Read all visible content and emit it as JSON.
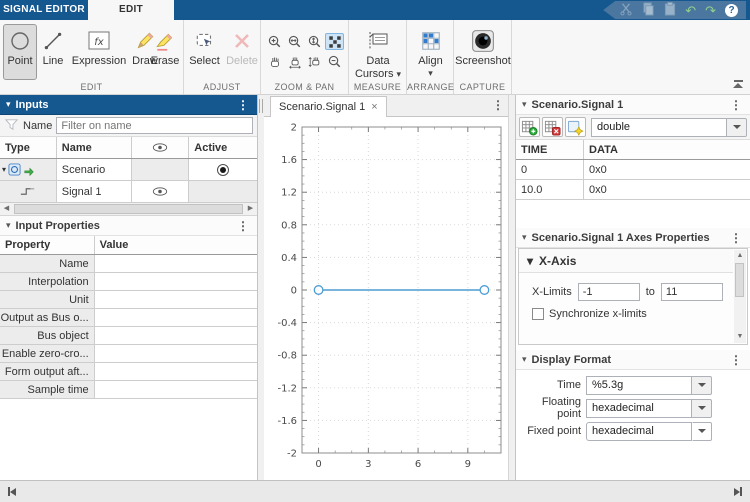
{
  "glyphs": {
    "menu_dots": "⋮",
    "caret_down": "▾",
    "close": "×",
    "undo": "↶",
    "redo": "↷",
    "help": "?",
    "left": "◀",
    "right": "▶",
    "up": "▲",
    "down": "▼"
  },
  "tabs": {
    "signal_editor": "SIGNAL EDITOR",
    "edit": "EDIT"
  },
  "toolstrip": {
    "buttons": {
      "point": "Point",
      "line": "Line",
      "expression": "Expression",
      "draw": "Draw",
      "erase": "Erase",
      "select": "Select",
      "delete": "Delete",
      "data_cursors_line1": "Data",
      "data_cursors_line2": "Cursors",
      "align": "Align",
      "screenshot": "Screenshot"
    },
    "sections": {
      "edit": "EDIT",
      "adjust": "ADJUST",
      "zoom_pan": "ZOOM & PAN",
      "measure": "MEASURE",
      "arrange": "ARRANGE",
      "capture": "CAPTURE"
    }
  },
  "inputs_panel": {
    "title": "Inputs",
    "filter_label": "Name",
    "filter_placeholder": "Filter on name",
    "columns": {
      "type": "Type",
      "name": "Name",
      "active": "Active"
    },
    "rows": [
      {
        "name": "Scenario"
      },
      {
        "name": "Signal 1"
      }
    ]
  },
  "input_properties": {
    "title": "Input Properties",
    "columns": {
      "property": "Property",
      "value": "Value"
    },
    "rows": [
      "Name",
      "Interpolation",
      "Unit",
      "Output as Bus o...",
      "Bus object",
      "Enable zero-cro...",
      "Form output aft...",
      "Sample time"
    ]
  },
  "document": {
    "tab_title": "Scenario.Signal 1"
  },
  "chart_data": {
    "type": "line",
    "title": "",
    "xlabel": "",
    "ylabel": "",
    "xlim": [
      -1,
      11
    ],
    "ylim": [
      -2,
      2
    ],
    "xticks": [
      0,
      3,
      6,
      9
    ],
    "yticks": [
      -2,
      -1.6,
      -1.2,
      -0.8,
      -0.4,
      0,
      0.4,
      0.8,
      1.2,
      1.6,
      2
    ],
    "x_minor_step": 1,
    "y_minor_step": 0.1,
    "grid": true,
    "legend": false,
    "series": [
      {
        "name": "Signal 1",
        "x": [
          0,
          10
        ],
        "y": [
          0,
          0
        ],
        "color": "#4c9cd4",
        "marker": "open-circle"
      }
    ]
  },
  "signal_panel": {
    "title": "Scenario.Signal 1",
    "datatype_value": "double",
    "columns": {
      "time": "TIME",
      "data": "DATA"
    },
    "rows": [
      {
        "time": "0",
        "data": "0x0"
      },
      {
        "time": "10.0",
        "data": "0x0"
      }
    ]
  },
  "axes_panel": {
    "title": "Scenario.Signal 1 Axes Properties",
    "section_title": "X-Axis",
    "xlimits_label": "X-Limits",
    "xlim_from": "-1",
    "to_label": "to",
    "xlim_to": "11",
    "sync_label": "Synchronize x-limits"
  },
  "display_format": {
    "title": "Display Format",
    "time_label": "Time",
    "time_value": "%5.3g",
    "floating_label": "Floating point",
    "floating_value": "hexadecimal",
    "fixed_label": "Fixed point",
    "fixed_value": "hexadecimal"
  }
}
